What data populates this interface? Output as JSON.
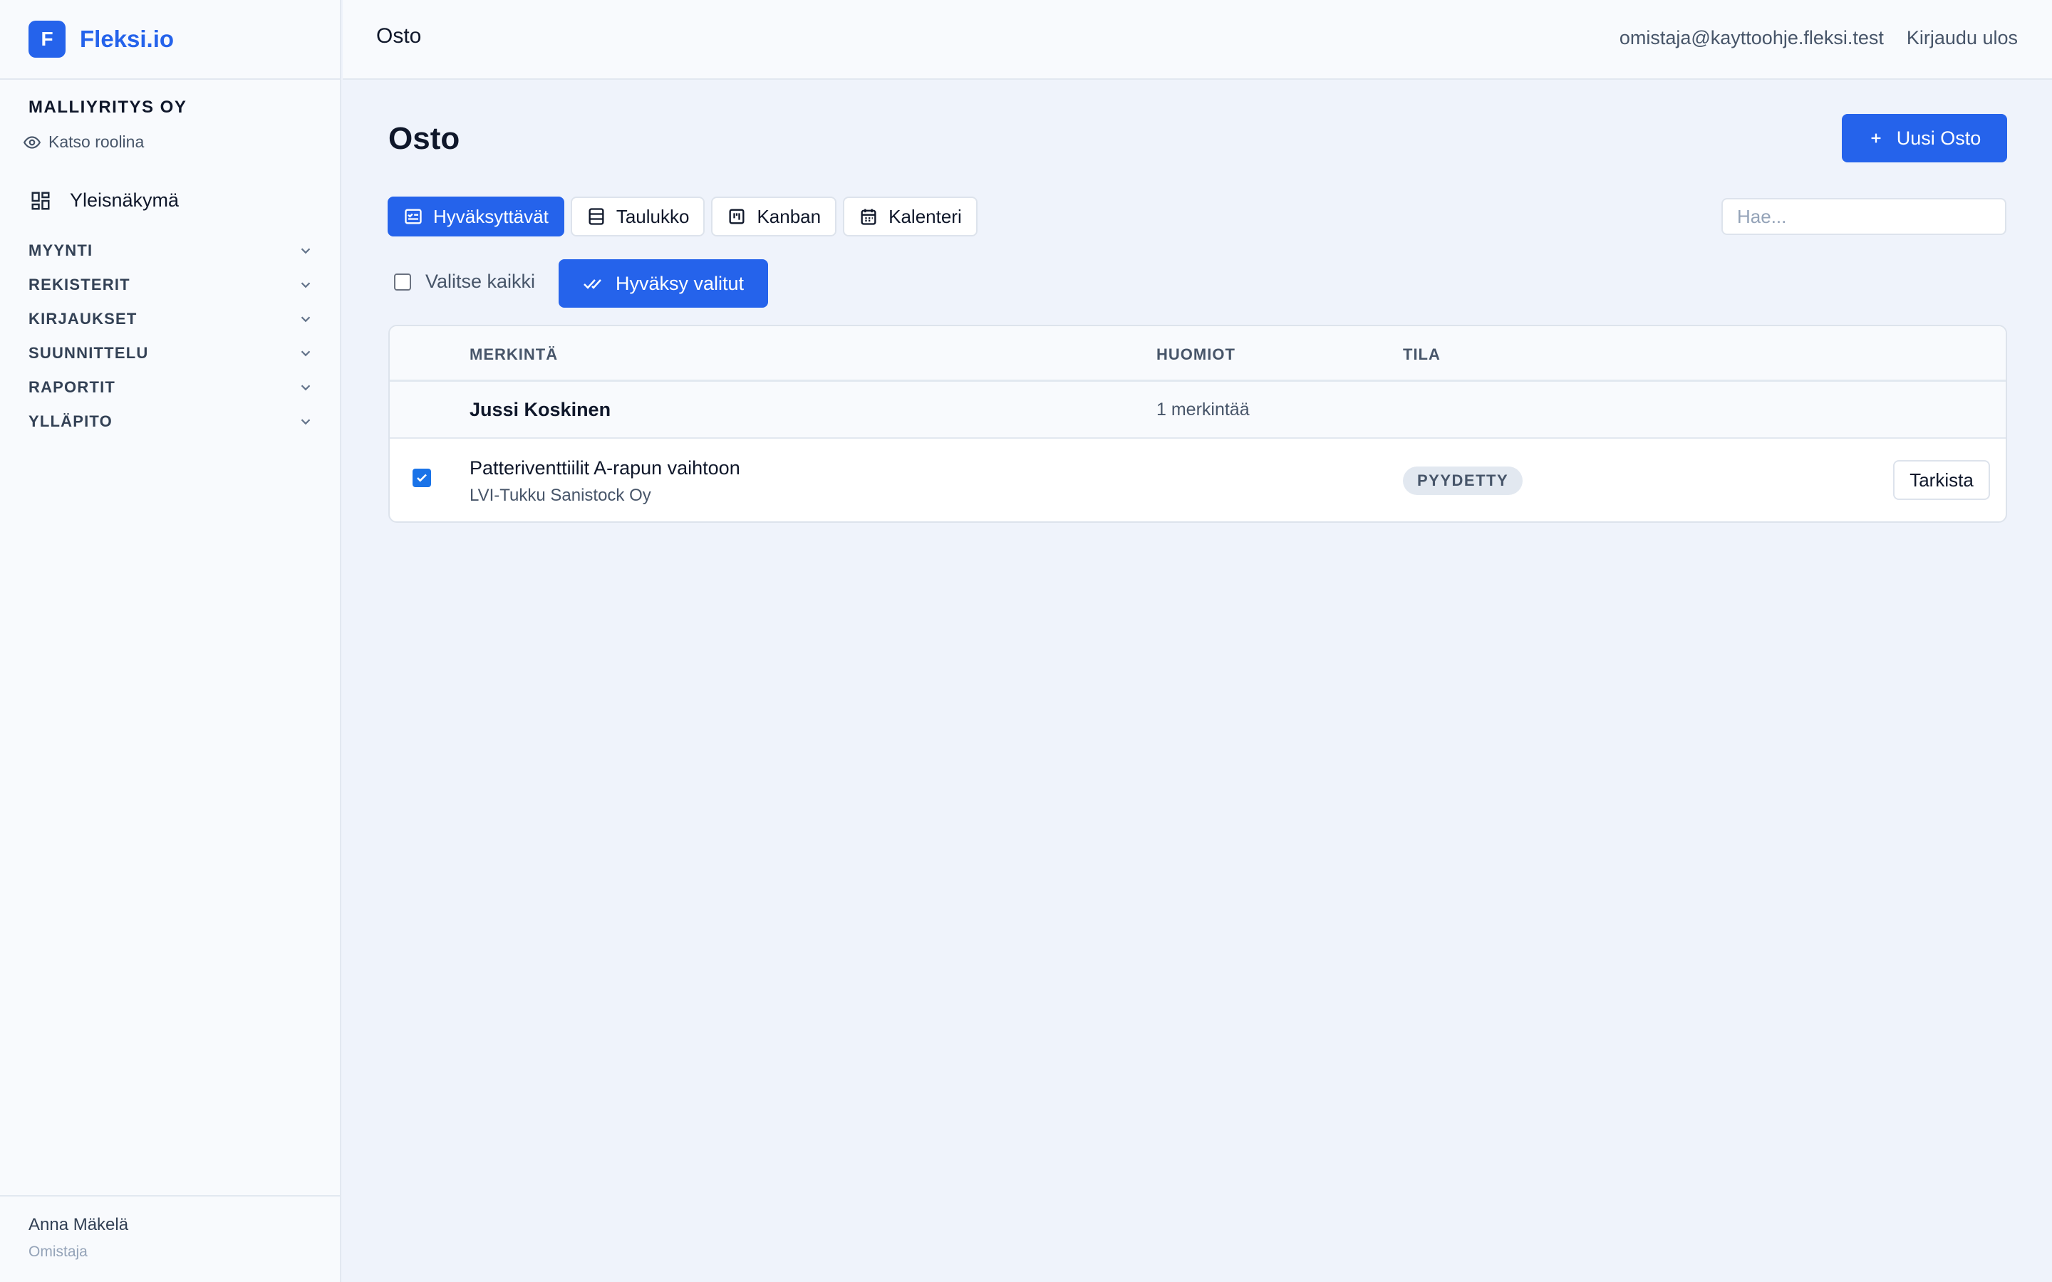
{
  "brand": {
    "logo_letter": "F",
    "name": "Fleksi.io"
  },
  "sidebar": {
    "company": "MALLIYRITYS OY",
    "view_as_role": "Katso roolina",
    "overview": "Yleisnäkymä",
    "sections": [
      "MYYNTI",
      "REKISTERIT",
      "KIRJAUKSET",
      "SUUNNITTELU",
      "RAPORTIT",
      "YLLÄPITO"
    ],
    "user": {
      "name": "Anna Mäkelä",
      "role": "Omistaja"
    }
  },
  "topbar": {
    "title": "Osto",
    "email": "omistaja@kayttoohje.fleksi.test",
    "logout": "Kirjaudu ulos"
  },
  "page": {
    "title": "Osto",
    "new_button": "Uusi Osto",
    "views": [
      {
        "label": "Hyväksyttävät",
        "icon": "approval-list-icon",
        "active": true
      },
      {
        "label": "Taulukko",
        "icon": "table-icon",
        "active": false
      },
      {
        "label": "Kanban",
        "icon": "kanban-icon",
        "active": false
      },
      {
        "label": "Kalenteri",
        "icon": "calendar-icon",
        "active": false
      }
    ],
    "search_placeholder": "Hae...",
    "select_all": "Valitse kaikki",
    "approve_selected": "Hyväksy valitut"
  },
  "table": {
    "headers": {
      "entry": "MERKINTÄ",
      "notes": "HUOMIOT",
      "status": "TILA"
    },
    "group": {
      "name": "Jussi Koskinen",
      "count": "1 merkintää"
    },
    "rows": [
      {
        "title": "Patteriventtiilit A-rapun vaihtoon",
        "supplier": "LVI-Tukku Sanistock Oy",
        "status": "PYYDETTY",
        "action": "Tarkista",
        "checked": true
      }
    ]
  },
  "colors": {
    "accent": "#2563eb",
    "background": "#eff3fb",
    "sidebar": "#f8fafd"
  }
}
